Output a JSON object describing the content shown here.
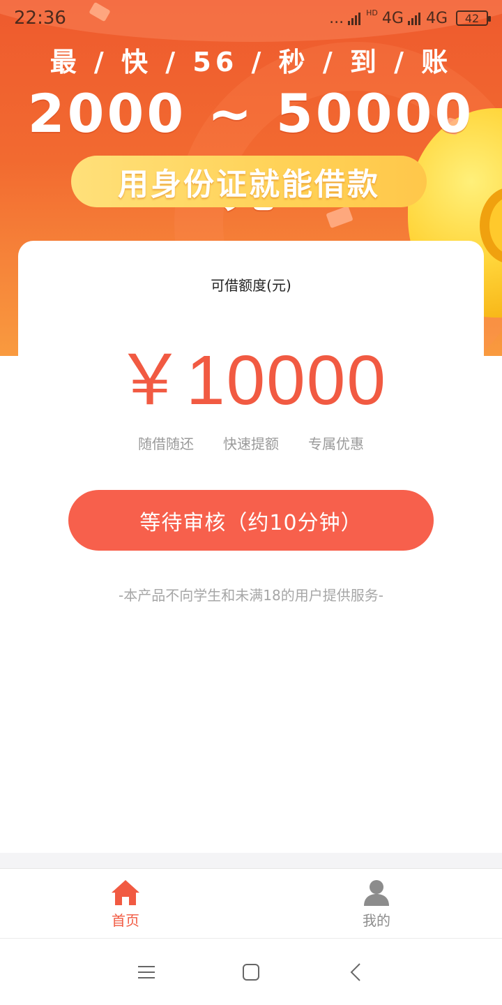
{
  "status_bar": {
    "time": "22:36",
    "dots": "...",
    "hd": "HD",
    "network_1": "4G",
    "network_2": "4G",
    "battery": "42"
  },
  "banner": {
    "headline": "最 / 快 / 56 / 秒 / 到 / 账",
    "range": "2000 ~ 50000元",
    "pill_text": "用身份证就能借款"
  },
  "card": {
    "label": "可借额度(元)",
    "amount": "￥10000",
    "features": [
      "随借随还",
      "快速提额",
      "专属优惠"
    ]
  },
  "cta": {
    "label": "等待审核（约10分钟）"
  },
  "disclaimer": "-本产品不向学生和未满18的用户提供服务-",
  "tabbar": {
    "home": "首页",
    "mine": "我的"
  },
  "colors": {
    "accent": "#f15a42",
    "button": "#f7604c",
    "banner_top": "#ee5a2e",
    "banner_bottom": "#f99a3f"
  },
  "icons": {
    "home": "home-icon",
    "mine": "user-icon",
    "menu": "menu-icon",
    "home_key": "square-home-icon",
    "back": "back-chevron-icon"
  }
}
